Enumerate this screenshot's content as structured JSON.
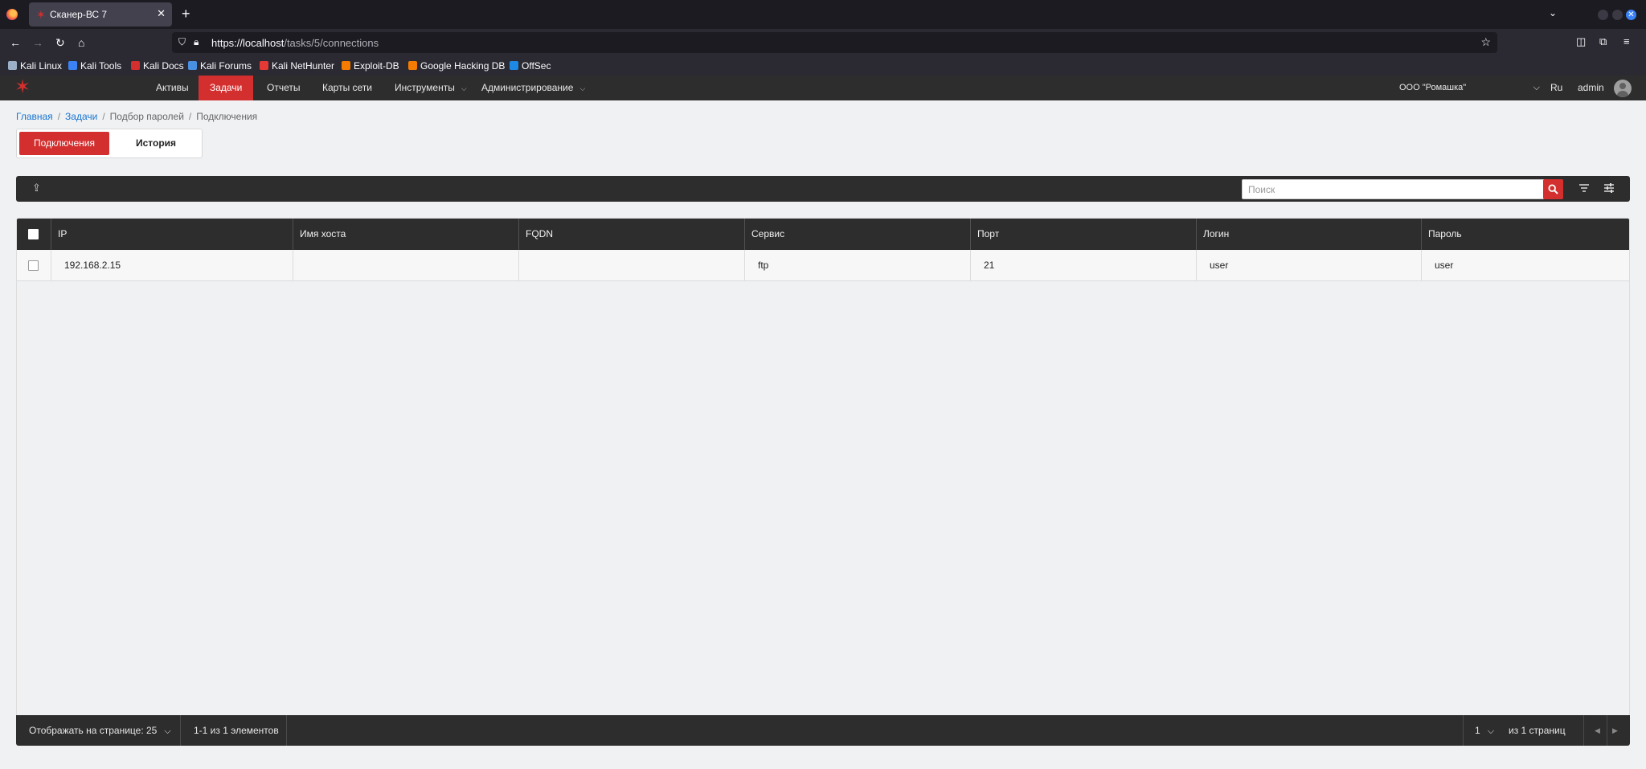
{
  "browser": {
    "tab_title": "Сканер-ВС 7",
    "tab_close": "✕",
    "new_tab": "+",
    "url_host": "https://localhost",
    "url_path": "/tasks/5/connections",
    "bookmarks": [
      {
        "label": "Kali Linux",
        "color": "#9bb0c8"
      },
      {
        "label": "Kali Tools",
        "color": "#3b82f6"
      },
      {
        "label": "Kali Docs",
        "color": "#d32f2f"
      },
      {
        "label": "Kali Forums",
        "color": "#4a90e2"
      },
      {
        "label": "Kali NetHunter",
        "color": "#e53935"
      },
      {
        "label": "Exploit-DB",
        "color": "#f57c00"
      },
      {
        "label": "Google Hacking DB",
        "color": "#f57c00"
      },
      {
        "label": "OffSec",
        "color": "#1e88e5"
      }
    ]
  },
  "app": {
    "menu": [
      "Активы",
      "Задачи",
      "Отчеты",
      "Карты сети",
      "Инструменты",
      "Администрирование"
    ],
    "active_menu": "Задачи",
    "organization": "ООО \"Ромашка\"",
    "language": "Ru",
    "user": "admin",
    "accent_color": "#d32f2f"
  },
  "breadcrumb": [
    "Главная",
    "Задачи",
    "Подбор паролей",
    "Подключения"
  ],
  "subtabs": [
    "Подключения",
    "История"
  ],
  "search": {
    "placeholder": "Поиск",
    "value": ""
  },
  "table": {
    "columns": [
      "IP",
      "Имя хоста",
      "FQDN",
      "Сервис",
      "Порт",
      "Логин",
      "Пароль"
    ],
    "rows": [
      {
        "ip": "192.168.2.15",
        "hostname": "",
        "fqdn": "",
        "service": "ftp",
        "port": "21",
        "login": "user",
        "password": "user"
      }
    ]
  },
  "footer": {
    "per_page_label": "Отображать на странице: 25",
    "range": "1-1 из 1 элементов",
    "page": "1",
    "pages_label": "из 1 страниц"
  }
}
